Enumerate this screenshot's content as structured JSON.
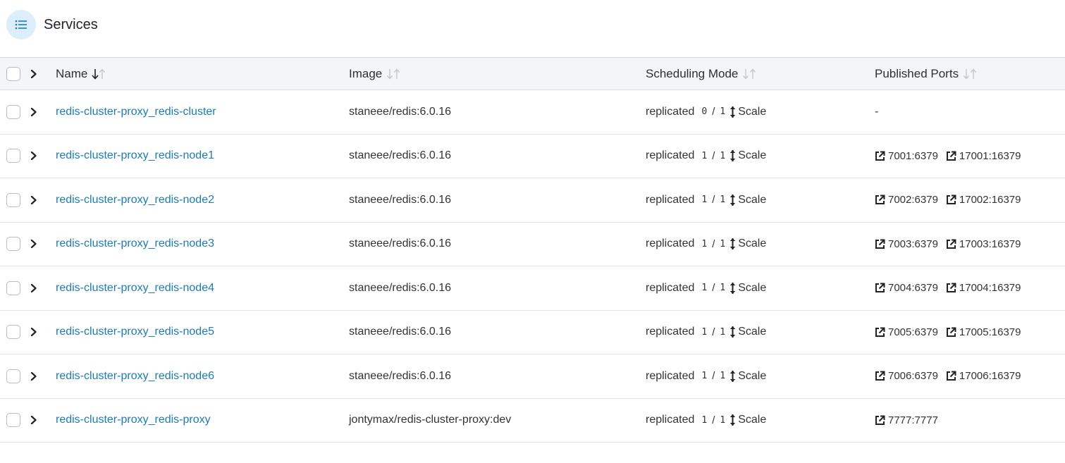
{
  "page": {
    "title": "Services",
    "title_icon": "list-icon"
  },
  "columns": {
    "name": "Name",
    "image": "Image",
    "mode": "Scheduling Mode",
    "ports": "Published Ports"
  },
  "scale_label": "Scale",
  "rows": [
    {
      "name": "redis-cluster-proxy_redis-cluster",
      "image": "staneee/redis:6.0.16",
      "mode": "replicated",
      "running": "0",
      "desired": "1",
      "ports": [
        "-"
      ]
    },
    {
      "name": "redis-cluster-proxy_redis-node1",
      "image": "staneee/redis:6.0.16",
      "mode": "replicated",
      "running": "1",
      "desired": "1",
      "ports": [
        "7001:6379",
        "17001:16379"
      ]
    },
    {
      "name": "redis-cluster-proxy_redis-node2",
      "image": "staneee/redis:6.0.16",
      "mode": "replicated",
      "running": "1",
      "desired": "1",
      "ports": [
        "7002:6379",
        "17002:16379"
      ]
    },
    {
      "name": "redis-cluster-proxy_redis-node3",
      "image": "staneee/redis:6.0.16",
      "mode": "replicated",
      "running": "1",
      "desired": "1",
      "ports": [
        "7003:6379",
        "17003:16379"
      ]
    },
    {
      "name": "redis-cluster-proxy_redis-node4",
      "image": "staneee/redis:6.0.16",
      "mode": "replicated",
      "running": "1",
      "desired": "1",
      "ports": [
        "7004:6379",
        "17004:16379"
      ]
    },
    {
      "name": "redis-cluster-proxy_redis-node5",
      "image": "staneee/redis:6.0.16",
      "mode": "replicated",
      "running": "1",
      "desired": "1",
      "ports": [
        "7005:6379",
        "17005:16379"
      ]
    },
    {
      "name": "redis-cluster-proxy_redis-node6",
      "image": "staneee/redis:6.0.16",
      "mode": "replicated",
      "running": "1",
      "desired": "1",
      "ports": [
        "7006:6379",
        "17006:16379"
      ]
    },
    {
      "name": "redis-cluster-proxy_redis-proxy",
      "image": "jontymax/redis-cluster-proxy:dev",
      "mode": "replicated",
      "running": "1",
      "desired": "1",
      "ports": [
        "7777:7777"
      ]
    }
  ],
  "colors": {
    "link": "#1b7bbd",
    "header_bg": "#f4f5f7",
    "icon_bg": "#dbeefa",
    "icon_fg": "#1b7bbd"
  }
}
